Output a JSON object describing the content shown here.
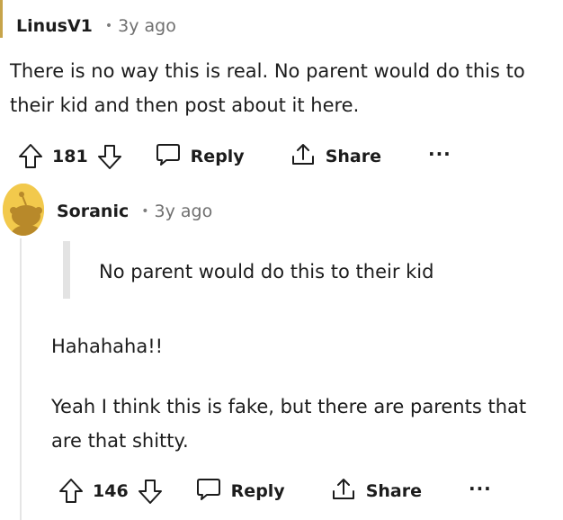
{
  "comments": [
    {
      "author": "LinusV1",
      "meta_separator": "•",
      "timestamp": "3y ago",
      "body": "There is no way this is real. No parent would do this to their kid and then post about it here.",
      "score": "181",
      "actions": {
        "reply": "Reply",
        "share": "Share",
        "more": "···"
      }
    },
    {
      "author": "Soranic",
      "meta_separator": "•",
      "timestamp": "3y ago",
      "quote": "No parent would do this to their kid",
      "body_paragraphs": [
        "Hahahaha!!",
        "Yeah I think this is fake, but there are parents that are that shitty."
      ],
      "score": "146",
      "actions": {
        "reply": "Reply",
        "share": "Share",
        "more": "···"
      }
    }
  ],
  "icons": {
    "upvote": "upvote-arrow-icon",
    "downvote": "downvote-arrow-icon",
    "reply": "speech-bubble-icon",
    "share": "share-upload-icon",
    "more": "ellipsis-icon",
    "avatar": "snoo-avatar-icon"
  },
  "colors": {
    "text": "#1c1c1c",
    "meta": "#6f6f6f",
    "avatar_bg": "#f2c94c",
    "thread_line": "#e5e5e5",
    "quote_bar": "#e3e3e3"
  }
}
